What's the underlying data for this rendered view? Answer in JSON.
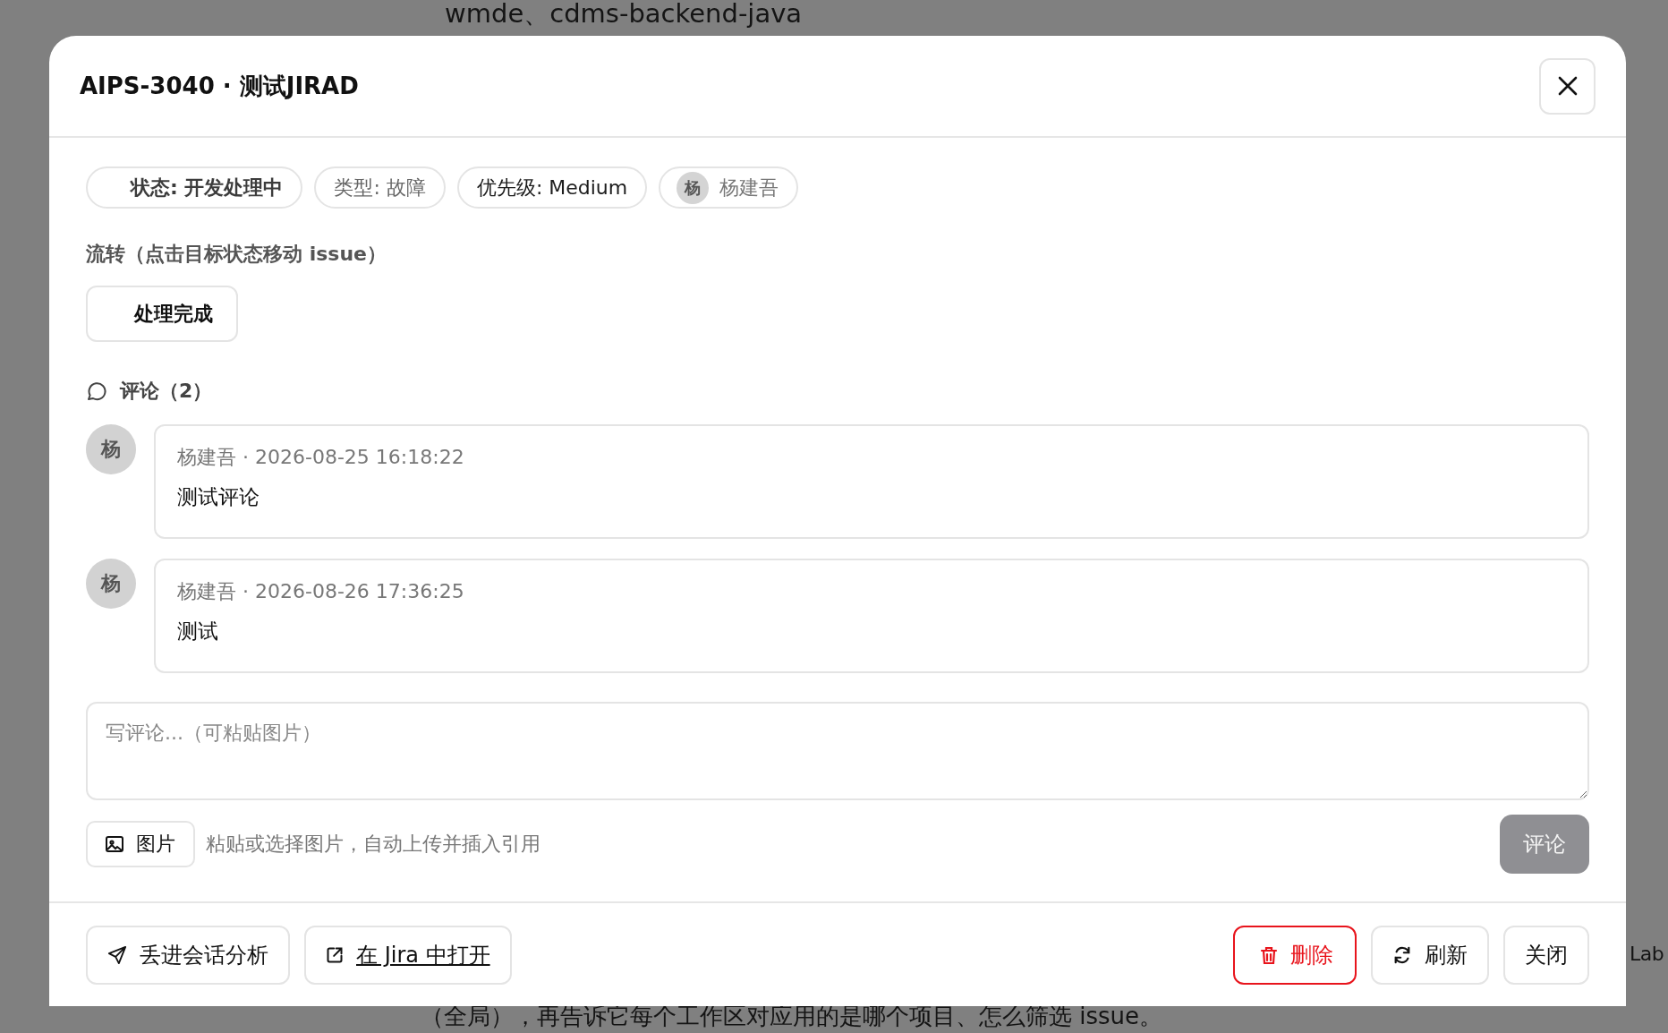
{
  "background": {
    "texts": [
      {
        "kind": "top",
        "text": "wmde、cdms-backend-java"
      },
      {
        "kind": "right",
        "text": "Lab"
      },
      {
        "kind": "bottom",
        "text": "（全局），再告诉它每个工作区对应用的是哪个项目、怎么筛选 issue。"
      }
    ]
  },
  "dialog": {
    "title": "AIPS-3040 · 测试JIRAD",
    "tags": [
      {
        "kind": "status",
        "label": "状态: 开发处理中"
      },
      {
        "kind": "type",
        "label": "类型: 故障"
      },
      {
        "kind": "priority",
        "label": "优先级: Medium"
      },
      {
        "kind": "person",
        "avatar": "杨",
        "label": "杨建吾"
      }
    ],
    "transitions": {
      "label": "流转（点击目标状态移动 issue）",
      "buttons": [
        "处理完成"
      ]
    },
    "comments": {
      "heading": "评论（2）",
      "items": [
        {
          "avatar": "杨",
          "meta": "杨建吾 · 2026-08-25 16:18:22",
          "text": "测试评论"
        },
        {
          "avatar": "杨",
          "meta": "杨建吾 · 2026-08-26 17:36:25",
          "text": "测试"
        }
      ]
    },
    "composer": {
      "placeholder": "写评论...（可粘贴图片）",
      "image_button": "图片",
      "hint": "粘贴或选择图片，自动上传并插入引用",
      "submit": {
        "label": "评论",
        "disabled": true
      }
    },
    "footer": {
      "left": [
        {
          "kind": "send",
          "label": "丢进会话分析"
        },
        {
          "kind": "link",
          "label": "在 Jira 中打开"
        }
      ],
      "right": [
        {
          "kind": "danger",
          "label": "删除"
        },
        {
          "kind": "refresh",
          "label": "刷新"
        },
        {
          "kind": "plain",
          "label": "关闭"
        }
      ]
    }
  }
}
